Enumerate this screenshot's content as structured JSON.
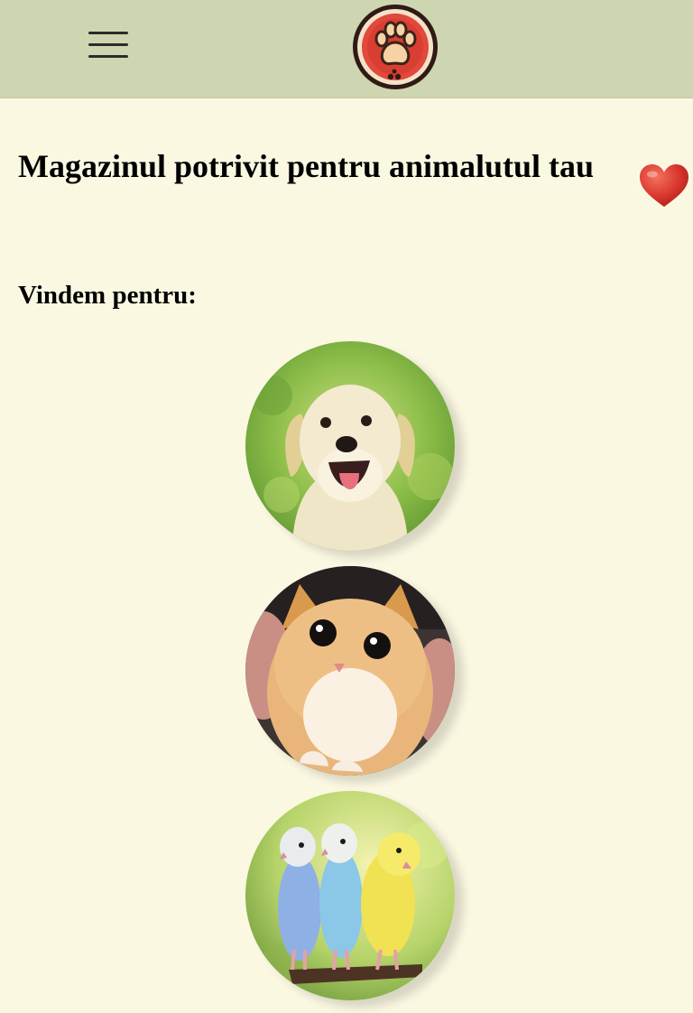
{
  "header": {
    "menu_icon": "hamburger-menu-icon",
    "logo_icon": "paw-print-logo-icon"
  },
  "main": {
    "title": "Magazinul potrivit pentru animalutul tau",
    "favorite_icon": "heart-icon",
    "subtitle": "Vindem pentru:",
    "pets": [
      {
        "icon": "puppy-photo"
      },
      {
        "icon": "kitten-photo"
      },
      {
        "icon": "parakeets-photo"
      }
    ]
  },
  "colors": {
    "background": "#fbf8e2",
    "header": "#ced6b1",
    "heart": "#d8342b",
    "logo_red": "#e2483c"
  }
}
